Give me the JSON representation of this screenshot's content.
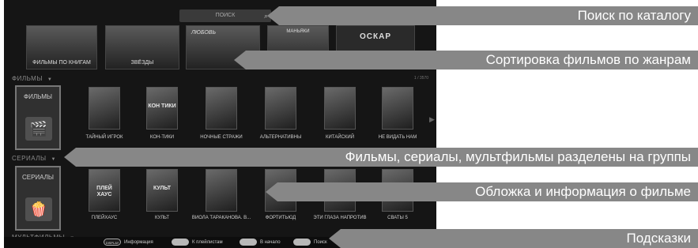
{
  "search": {
    "placeholder": "ПОИСК",
    "icon": "search-icon"
  },
  "banners": [
    "ФИЛЬМЫ ПО КНИГАМ",
    "ЗВЁЗДЫ",
    "ЛЮБОВЬ",
    "МАНЬЯКИ",
    "ОСКАР"
  ],
  "films": {
    "header": "ФИЛЬМЫ",
    "counter": "1 / 3570",
    "category_label": "ФИЛЬМЫ",
    "items": [
      {
        "title": "ТАЙНЫЙ ИГРОК",
        "poster_text": ""
      },
      {
        "title": "КОН-ТИКИ",
        "poster_text": "КОН ТИКИ"
      },
      {
        "title": "НОЧНЫЕ СТРАЖИ",
        "poster_text": ""
      },
      {
        "title": "АЛЬТЕРНАТИВНЫ",
        "poster_text": ""
      },
      {
        "title": "КИТАЙСКИЙ",
        "poster_text": ""
      },
      {
        "title": "НЕ ВИДАТЬ НАМ",
        "poster_text": ""
      }
    ]
  },
  "serials": {
    "header": "СЕРИАЛЫ",
    "category_label": "СЕРИАЛЫ",
    "items": [
      {
        "title": "ПЛЕЙХАУС",
        "poster_text": "ПЛЕЙ ХАУС"
      },
      {
        "title": "КУЛЬТ",
        "poster_text": "КУЛЬТ"
      },
      {
        "title": "ВИОЛА ТАРАКАНОВА. В...",
        "poster_text": ""
      },
      {
        "title": "ФОРТИТЬЮД",
        "poster_text": ""
      },
      {
        "title": "ЭТИ ГЛАЗА НАПРОТИВ",
        "poster_text": ""
      },
      {
        "title": "СВАТЫ 5",
        "poster_text": ""
      }
    ]
  },
  "cartoons": {
    "header": "МУЛЬТФИЛЬМЫ"
  },
  "hints": [
    {
      "key": "DISPLAY",
      "label": "Информация"
    },
    {
      "key": "",
      "label": "К плейлистам"
    },
    {
      "key": "",
      "label": "В начало"
    },
    {
      "key": "",
      "label": "Поиск"
    }
  ],
  "callouts": [
    "Поиск по каталогу",
    "Сортировка фильмов по жанрам",
    "Фильмы, сериалы, мультфильмы разделены на группы",
    "Обложка и информация о фильме",
    "Подсказки"
  ],
  "colors": {
    "callout_bg": "#878787",
    "screen_bg": "#151515"
  }
}
